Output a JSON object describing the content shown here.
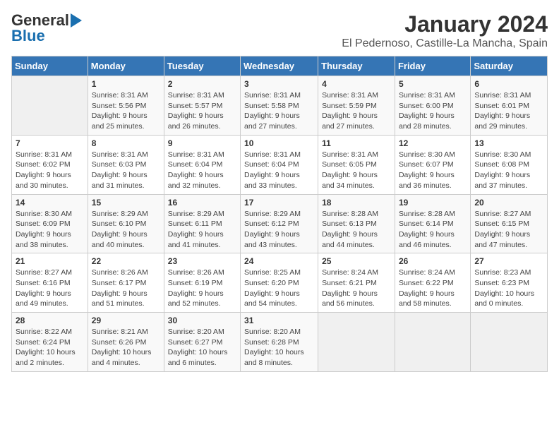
{
  "header": {
    "logo_general": "General",
    "logo_blue": "Blue",
    "title": "January 2024",
    "subtitle": "El Pedernoso, Castille-La Mancha, Spain"
  },
  "calendar": {
    "headers": [
      "Sunday",
      "Monday",
      "Tuesday",
      "Wednesday",
      "Thursday",
      "Friday",
      "Saturday"
    ],
    "weeks": [
      [
        {
          "day": "",
          "info": ""
        },
        {
          "day": "1",
          "info": "Sunrise: 8:31 AM\nSunset: 5:56 PM\nDaylight: 9 hours\nand 25 minutes."
        },
        {
          "day": "2",
          "info": "Sunrise: 8:31 AM\nSunset: 5:57 PM\nDaylight: 9 hours\nand 26 minutes."
        },
        {
          "day": "3",
          "info": "Sunrise: 8:31 AM\nSunset: 5:58 PM\nDaylight: 9 hours\nand 27 minutes."
        },
        {
          "day": "4",
          "info": "Sunrise: 8:31 AM\nSunset: 5:59 PM\nDaylight: 9 hours\nand 27 minutes."
        },
        {
          "day": "5",
          "info": "Sunrise: 8:31 AM\nSunset: 6:00 PM\nDaylight: 9 hours\nand 28 minutes."
        },
        {
          "day": "6",
          "info": "Sunrise: 8:31 AM\nSunset: 6:01 PM\nDaylight: 9 hours\nand 29 minutes."
        }
      ],
      [
        {
          "day": "7",
          "info": ""
        },
        {
          "day": "8",
          "info": "Sunrise: 8:31 AM\nSunset: 6:03 PM\nDaylight: 9 hours\nand 31 minutes."
        },
        {
          "day": "9",
          "info": "Sunrise: 8:31 AM\nSunset: 6:04 PM\nDaylight: 9 hours\nand 32 minutes."
        },
        {
          "day": "10",
          "info": "Sunrise: 8:31 AM\nSunset: 6:04 PM\nDaylight: 9 hours\nand 33 minutes."
        },
        {
          "day": "11",
          "info": "Sunrise: 8:31 AM\nSunset: 6:05 PM\nDaylight: 9 hours\nand 34 minutes."
        },
        {
          "day": "12",
          "info": "Sunrise: 8:30 AM\nSunset: 6:07 PM\nDaylight: 9 hours\nand 36 minutes."
        },
        {
          "day": "13",
          "info": "Sunrise: 8:30 AM\nSunset: 6:08 PM\nDaylight: 9 hours\nand 37 minutes."
        }
      ],
      [
        {
          "day": "14",
          "info": ""
        },
        {
          "day": "15",
          "info": "Sunrise: 8:29 AM\nSunset: 6:10 PM\nDaylight: 9 hours\nand 40 minutes."
        },
        {
          "day": "16",
          "info": "Sunrise: 8:29 AM\nSunset: 6:11 PM\nDaylight: 9 hours\nand 41 minutes."
        },
        {
          "day": "17",
          "info": "Sunrise: 8:29 AM\nSunset: 6:12 PM\nDaylight: 9 hours\nand 43 minutes."
        },
        {
          "day": "18",
          "info": "Sunrise: 8:28 AM\nSunset: 6:13 PM\nDaylight: 9 hours\nand 44 minutes."
        },
        {
          "day": "19",
          "info": "Sunrise: 8:28 AM\nSunset: 6:14 PM\nDaylight: 9 hours\nand 46 minutes."
        },
        {
          "day": "20",
          "info": "Sunrise: 8:27 AM\nSunset: 6:15 PM\nDaylight: 9 hours\nand 47 minutes."
        }
      ],
      [
        {
          "day": "21",
          "info": ""
        },
        {
          "day": "22",
          "info": "Sunrise: 8:26 AM\nSunset: 6:17 PM\nDaylight: 9 hours\nand 51 minutes."
        },
        {
          "day": "23",
          "info": "Sunrise: 8:26 AM\nSunset: 6:19 PM\nDaylight: 9 hours\nand 52 minutes."
        },
        {
          "day": "24",
          "info": "Sunrise: 8:25 AM\nSunset: 6:20 PM\nDaylight: 9 hours\nand 54 minutes."
        },
        {
          "day": "25",
          "info": "Sunrise: 8:24 AM\nSunset: 6:21 PM\nDaylight: 9 hours\nand 56 minutes."
        },
        {
          "day": "26",
          "info": "Sunrise: 8:24 AM\nSunset: 6:22 PM\nDaylight: 9 hours\nand 58 minutes."
        },
        {
          "day": "27",
          "info": "Sunrise: 8:23 AM\nSunset: 6:23 PM\nDaylight: 10 hours\nand 0 minutes."
        }
      ],
      [
        {
          "day": "28",
          "info": ""
        },
        {
          "day": "29",
          "info": "Sunrise: 8:21 AM\nSunset: 6:26 PM\nDaylight: 10 hours\nand 4 minutes."
        },
        {
          "day": "30",
          "info": "Sunrise: 8:20 AM\nSunset: 6:27 PM\nDaylight: 10 hours\nand 6 minutes."
        },
        {
          "day": "31",
          "info": "Sunrise: 8:20 AM\nSunset: 6:28 PM\nDaylight: 10 hours\nand 8 minutes."
        },
        {
          "day": "",
          "info": ""
        },
        {
          "day": "",
          "info": ""
        },
        {
          "day": "",
          "info": ""
        }
      ]
    ],
    "week_sunday_info": [
      "",
      "Sunrise: 8:31 AM\nSunset: 6:02 PM\nDaylight: 9 hours\nand 30 minutes.",
      "Sunrise: 8:30 AM\nSunset: 6:09 PM\nDaylight: 9 hours\nand 38 minutes.",
      "Sunrise: 8:27 AM\nSunset: 6:16 PM\nDaylight: 9 hours\nand 49 minutes.",
      "Sunrise: 8:22 AM\nSunset: 6:24 PM\nDaylight: 10 hours\nand 2 minutes."
    ]
  }
}
